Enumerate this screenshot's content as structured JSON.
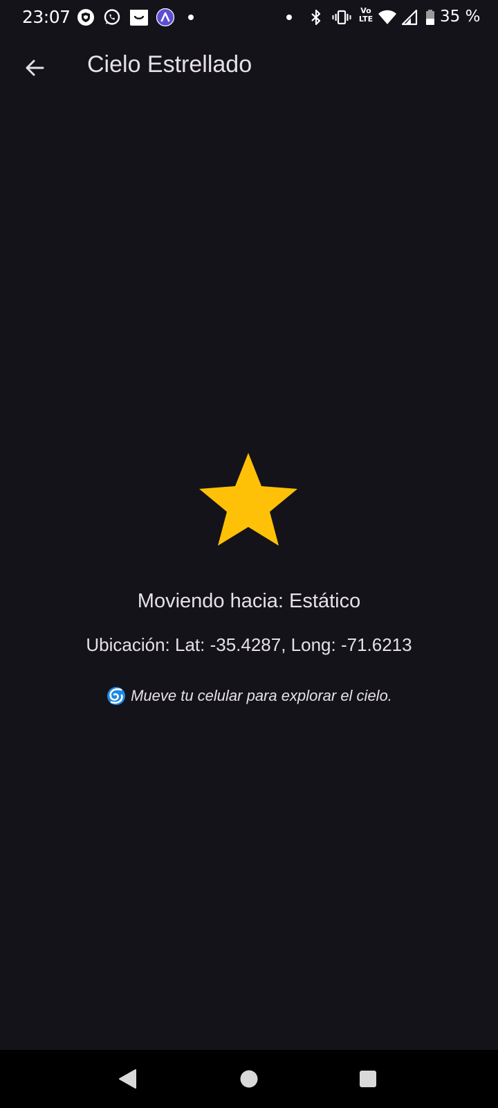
{
  "status_bar": {
    "time": "23:07",
    "left_icons": [
      "vpn-shield-icon",
      "whatsapp-icon",
      "shopping-bag-icon",
      "app-a-icon",
      "notification-dot-icon"
    ],
    "right_icons": [
      "dot-icon",
      "bluetooth-icon",
      "vibrate-icon",
      "volte-lte-icon",
      "wifi-icon",
      "signal-icon",
      "battery-icon"
    ],
    "volte_label": "Vo",
    "lte_label": "LTE",
    "battery": "35 %"
  },
  "app_bar": {
    "title": "Cielo Estrellado",
    "back_icon": "arrow-back-icon"
  },
  "content": {
    "star_icon": "star-icon",
    "star_color": "#FFC107",
    "direction": "Moviendo hacia: Estático",
    "location": "Ubicación: Lat: -35.4287, Long: -71.6213",
    "hint_icon": "cyclone-icon",
    "hint": "Mueve tu celular para explorar el cielo."
  },
  "nav_bar": {
    "buttons": [
      "back-triangle-icon",
      "home-circle-icon",
      "recents-square-icon"
    ]
  },
  "colors": {
    "background": "#15131A",
    "text": "#E6E1E8",
    "nav_background": "#000000",
    "app_icon_purple": "#5B4FD6",
    "hint_icon_blue": "#1E88E5"
  }
}
